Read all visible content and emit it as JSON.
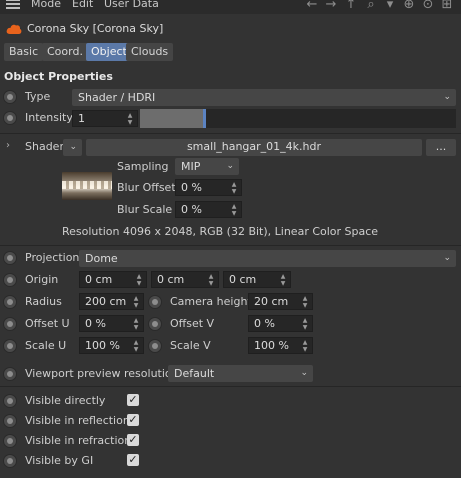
{
  "menubar": {
    "items": [
      "Mode",
      "Edit",
      "User Data"
    ]
  },
  "header": {
    "title": "Corona Sky [Corona Sky]"
  },
  "tabs": [
    {
      "label": "Basic"
    },
    {
      "label": "Coord."
    },
    {
      "label": "Object",
      "active": true
    },
    {
      "label": "Clouds"
    }
  ],
  "section_title": "Object Properties",
  "type": {
    "label": "Type",
    "value": "Shader / HDRI"
  },
  "intensity": {
    "label": "Intensity",
    "value": "1",
    "slider_fraction": 0.2
  },
  "shader": {
    "label": "Shader",
    "file": "small_hangar_01_4k.hdr",
    "more_button": "...",
    "sampling_label": "Sampling",
    "sampling_value": "MIP",
    "blur_offset_label": "Blur Offset",
    "blur_offset_value": "0 %",
    "blur_scale_label": "Blur Scale",
    "blur_scale_value": "0 %",
    "resolution": "Resolution 4096 x 2048, RGB (32 Bit), Linear Color Space"
  },
  "projection": {
    "label": "Projection",
    "value": "Dome"
  },
  "origin": {
    "label": "Origin",
    "x": "0 cm",
    "y": "0 cm",
    "z": "0 cm"
  },
  "radius": {
    "label": "Radius",
    "value": "200 cm"
  },
  "camera_height": {
    "label": "Camera height",
    "value": "20 cm"
  },
  "offset_u": {
    "label": "Offset U",
    "value": "0 %"
  },
  "offset_v": {
    "label": "Offset V",
    "value": "0 %"
  },
  "scale_u": {
    "label": "Scale U",
    "value": "100 %"
  },
  "scale_v": {
    "label": "Scale V",
    "value": "100 %"
  },
  "viewport": {
    "label": "Viewport preview resolution",
    "value": "Default"
  },
  "visibility": [
    {
      "label": "Visible directly",
      "checked": true
    },
    {
      "label": "Visible in reflections",
      "checked": true
    },
    {
      "label": "Visible in refractions",
      "checked": true
    },
    {
      "label": "Visible by GI",
      "checked": true
    }
  ],
  "colors": {
    "accent": "#5b79a8",
    "slider_marker": "#5b83c2",
    "cloud_icon": "#e8631c"
  }
}
